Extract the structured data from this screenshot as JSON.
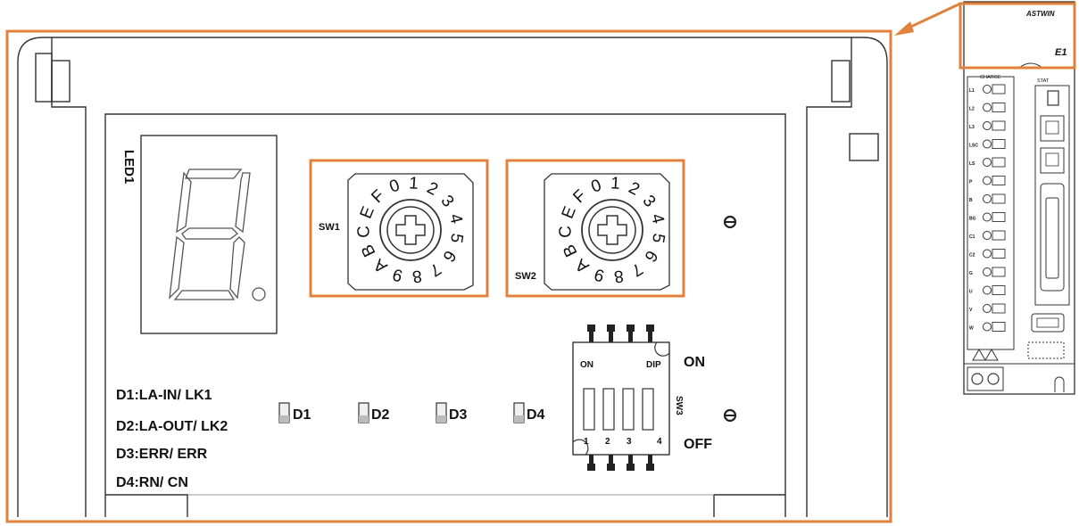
{
  "colors": {
    "highlight": "#e0823b",
    "line": "#333333",
    "text": "#111111",
    "fill": "#f4f4f4"
  },
  "display": {
    "led_label": "LED1"
  },
  "rotary_switches": [
    {
      "label": "SW1",
      "digits": [
        "0",
        "1",
        "2",
        "3",
        "4",
        "5",
        "6",
        "7",
        "8",
        "9",
        "A",
        "B",
        "C",
        "E",
        "F"
      ]
    },
    {
      "label": "SW2",
      "digits": [
        "0",
        "1",
        "2",
        "3",
        "4",
        "5",
        "6",
        "7",
        "8",
        "9",
        "A",
        "B",
        "C",
        "E",
        "F"
      ]
    }
  ],
  "legend": [
    "D1:LA-IN/ LK1",
    "D2:LA-OUT/ LK2",
    "D3:ERR/ ERR",
    "D4:RN/ CN"
  ],
  "leds": [
    "D1",
    "D2",
    "D3",
    "D4"
  ],
  "dip_switch": {
    "label": "SW3",
    "on_small": "ON",
    "dip_text": "DIP",
    "on_label": "ON",
    "off_label": "OFF",
    "positions": [
      "1",
      "2",
      "3",
      "4"
    ]
  },
  "drive": {
    "model_text": "ASTWIN",
    "front_label": "E1",
    "charge_label": "CHARGE",
    "stat_label": "STAT",
    "terminals": [
      "L1",
      "L2",
      "L3",
      "LSC",
      "LS",
      "P",
      "B",
      "BG",
      "C1",
      "C2",
      "G",
      "U",
      "V",
      "W"
    ]
  }
}
